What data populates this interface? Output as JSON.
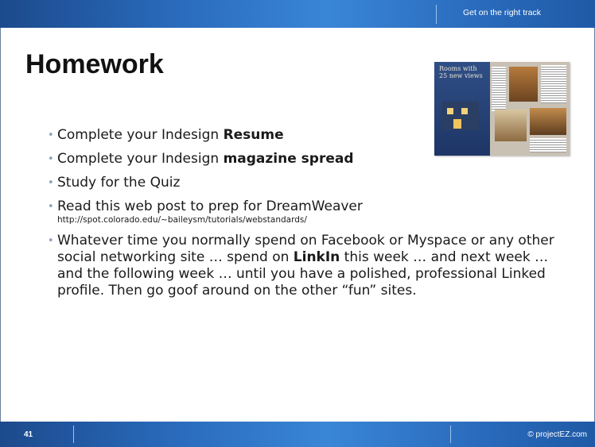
{
  "header": {
    "tagline": "Get on the right track"
  },
  "slide": {
    "title": "Homework",
    "image": {
      "overlay_text_line1": "Rooms with",
      "overlay_text_line2": "25 new views"
    },
    "bullets": [
      {
        "pre": "Complete your Indesign ",
        "bold": "Resume",
        "post": ""
      },
      {
        "pre": "Complete your Indesign ",
        "bold": "magazine spread",
        "post": ""
      },
      {
        "text": "Study for the Quiz"
      },
      {
        "text": "Read this web post to prep for DreamWeaver",
        "url": "http://spot.colorado.edu/~baileysm/tutorials/webstandards/"
      },
      {
        "pre": "Whatever time you normally spend on Facebook or Myspace or any other social networking site … spend on ",
        "bold": "LinkIn",
        "post": " this week … and next week … and the following week … until you have a polished, professional Linked profile. Then go goof around on the other “fun” sites."
      }
    ]
  },
  "footer": {
    "slide_number": "41",
    "copyright": "© projectEZ.com"
  },
  "colors": {
    "bar_dark": "#1c4a8c",
    "bar_light": "#3a86d6",
    "bullet": "#8c9fb8"
  }
}
